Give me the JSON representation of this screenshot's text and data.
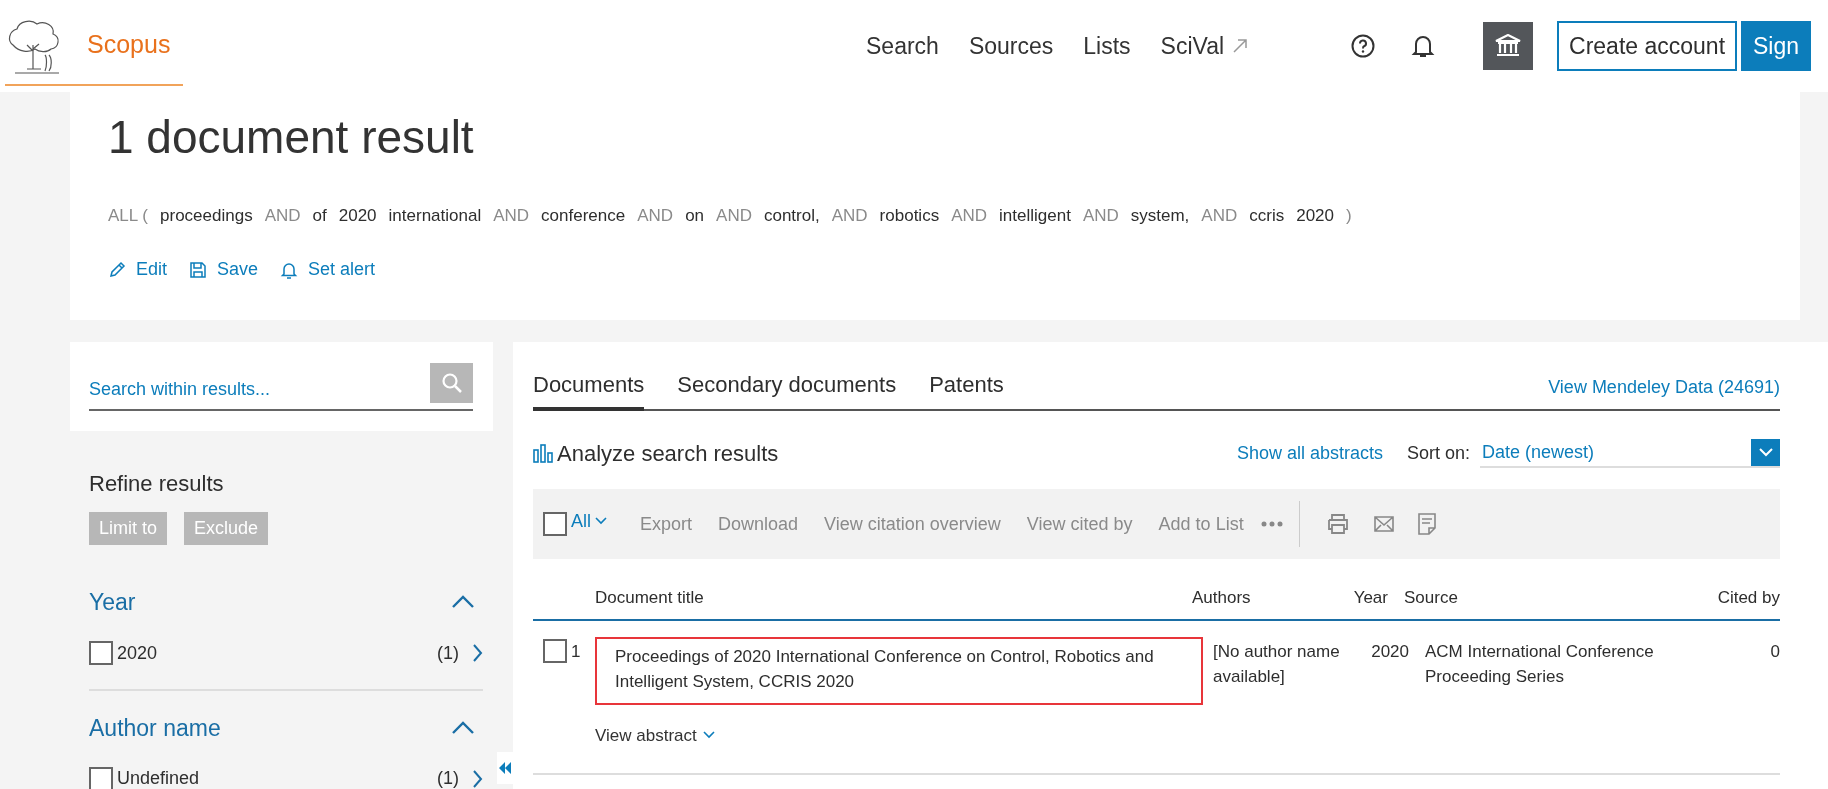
{
  "header": {
    "brand": "Scopus",
    "nav": [
      {
        "label": "Search",
        "external": false
      },
      {
        "label": "Sources",
        "external": false
      },
      {
        "label": "Lists",
        "external": false
      },
      {
        "label": "SciVal",
        "external": true
      }
    ],
    "create_account": "Create account",
    "sign_in": "Sign"
  },
  "result": {
    "title": "1 document result",
    "query": [
      {
        "text": "ALL (",
        "kind": "operator"
      },
      {
        "text": "proceedings",
        "kind": "term"
      },
      {
        "text": "AND",
        "kind": "operator"
      },
      {
        "text": "of",
        "kind": "term"
      },
      {
        "text": "2020",
        "kind": "term"
      },
      {
        "text": "international",
        "kind": "term"
      },
      {
        "text": "AND",
        "kind": "operator"
      },
      {
        "text": "conference",
        "kind": "term"
      },
      {
        "text": "AND",
        "kind": "operator"
      },
      {
        "text": "on",
        "kind": "term"
      },
      {
        "text": "AND",
        "kind": "operator"
      },
      {
        "text": "control,",
        "kind": "term"
      },
      {
        "text": "AND",
        "kind": "operator"
      },
      {
        "text": "robotics",
        "kind": "term"
      },
      {
        "text": "AND",
        "kind": "operator"
      },
      {
        "text": "intelligent",
        "kind": "term"
      },
      {
        "text": "AND",
        "kind": "operator"
      },
      {
        "text": "system,",
        "kind": "term"
      },
      {
        "text": "AND",
        "kind": "operator"
      },
      {
        "text": "ccris",
        "kind": "term"
      },
      {
        "text": "2020",
        "kind": "term"
      },
      {
        "text": ")",
        "kind": "operator"
      }
    ],
    "actions": [
      {
        "label": "Edit",
        "kind": "edit"
      },
      {
        "label": "Save",
        "kind": "save"
      },
      {
        "label": "Set alert",
        "kind": "alert"
      }
    ]
  },
  "sidebar": {
    "search": {
      "placeholder": "Search within results..."
    },
    "refine_title": "Refine results",
    "refine_buttons": [
      "Limit to",
      "Exclude"
    ],
    "facets": [
      {
        "title": "Year",
        "expanded": true,
        "items": [
          {
            "label": "2020",
            "count": "(1)",
            "checked": false
          }
        ]
      },
      {
        "title": "Author name",
        "expanded": true,
        "items": [
          {
            "label": "Undefined",
            "count": "(1)",
            "checked": false
          }
        ]
      }
    ]
  },
  "tabs": [
    {
      "label": "Documents",
      "selected": true
    },
    {
      "label": "Secondary documents",
      "selected": false
    },
    {
      "label": "Patents",
      "selected": false
    }
  ],
  "mendeley_link": "View Mendeley Data (24691)",
  "analyze": "Analyze search results",
  "show_abstracts": "Show all abstracts",
  "sort": {
    "label": "Sort on:",
    "value": "Date (newest)"
  },
  "toolbar": {
    "select_all": {
      "label": "All",
      "checked": false
    },
    "actions": [
      "Export",
      "Download",
      "View citation overview",
      "View cited by",
      "Add to List"
    ]
  },
  "table": {
    "columns": [
      "Document title",
      "Authors",
      "Year",
      "Source",
      "Cited by"
    ],
    "rows": [
      {
        "number": "1",
        "checked": false,
        "highlighted": true,
        "title": "Proceedings of 2020 International Conference on Control, Robotics and Intelligent System, CCRIS 2020",
        "authors": "[No author name available]",
        "year": "2020",
        "source": "ACM International Conference Proceeding Series",
        "cited_by": "0",
        "view_abstract": "View abstract"
      }
    ]
  }
}
